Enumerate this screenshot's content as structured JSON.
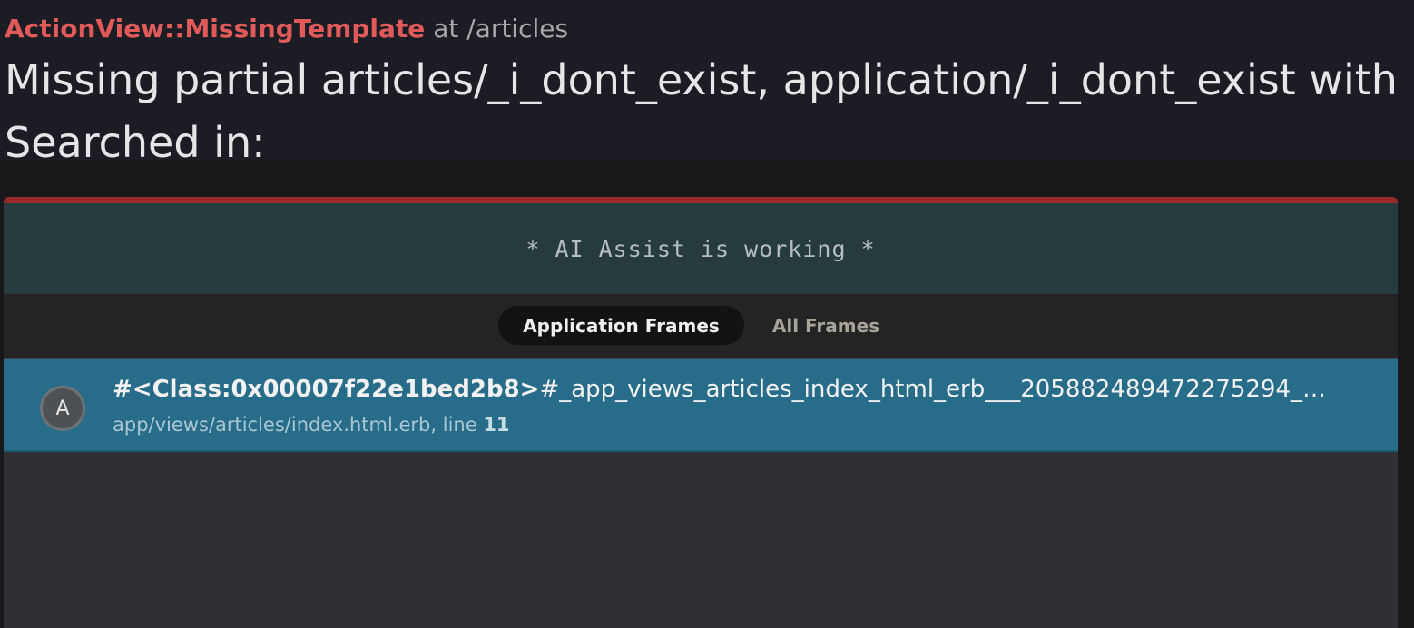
{
  "header": {
    "exception_class": "ActionView::MissingTemplate",
    "location": "at /articles",
    "message": "Missing partial articles/_i_dont_exist, application/_i_dont_exist with {",
    "searched_in": "Searched in:"
  },
  "ai_banner": {
    "text": "* AI Assist is working *"
  },
  "tabs": [
    {
      "label": "Application Frames",
      "active": true
    },
    {
      "label": "All Frames",
      "active": false
    }
  ],
  "frames": [
    {
      "badge": "A",
      "class_name": "#<Class:0x00007f22e1bed2b8>",
      "method": "#_app_views_articles_index_html_erb___205882489472275294_…",
      "file": "app/views/articles/index.html.erb, line ",
      "line": "11"
    }
  ],
  "colors": {
    "exception_class": "#e05a5a",
    "frame_row": "#276c89",
    "ai_banner": "#253b3d",
    "panel_border": "#9a2a2a"
  }
}
